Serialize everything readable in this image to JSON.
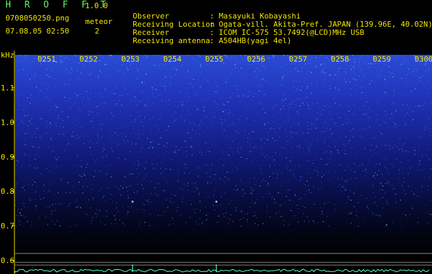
{
  "header": {
    "app_title": "H R O F F T",
    "version": "1.0.0",
    "filename": "0708050250.png",
    "datetime": "07.08.05 02:50",
    "meteor_label": "meteor",
    "meteor_count": "2"
  },
  "info": [
    {
      "key": "Observer",
      "sep": ":",
      "value": "Masayuki Kobayashi"
    },
    {
      "key": "Receiving Location",
      "sep": ":",
      "value": "Ogata-vill. Akita-Pref. JAPAN (139.96E, 40.02N)"
    },
    {
      "key": "Receiver",
      "sep": ":",
      "value": "ICOM IC-575 53.7492(@LCD)MHz USB"
    },
    {
      "key": "Receiving antenna",
      "sep": ":",
      "value": "A504HB(yagi 4el)"
    }
  ],
  "chart_data": {
    "type": "heatmap",
    "ylabel": "kHz",
    "y_ticks": [
      "1.1",
      "1.0",
      "0.9",
      "0.8",
      "0.7",
      "0.6"
    ],
    "x_ticks": [
      "0251",
      "0252",
      "0253",
      "0254",
      "0255",
      "0256",
      "0257",
      "0258",
      "0259",
      "0300"
    ],
    "meteors": [
      {
        "time": "0253",
        "freq_khz": 0.77
      },
      {
        "time": "0255",
        "freq_khz": 0.77
      }
    ],
    "colors": {
      "noise_high": "#4aa0ff",
      "noise_low": "#1a2aa0",
      "background": "#000000",
      "axis": "#f2e600",
      "trace": "#5affd0"
    }
  }
}
